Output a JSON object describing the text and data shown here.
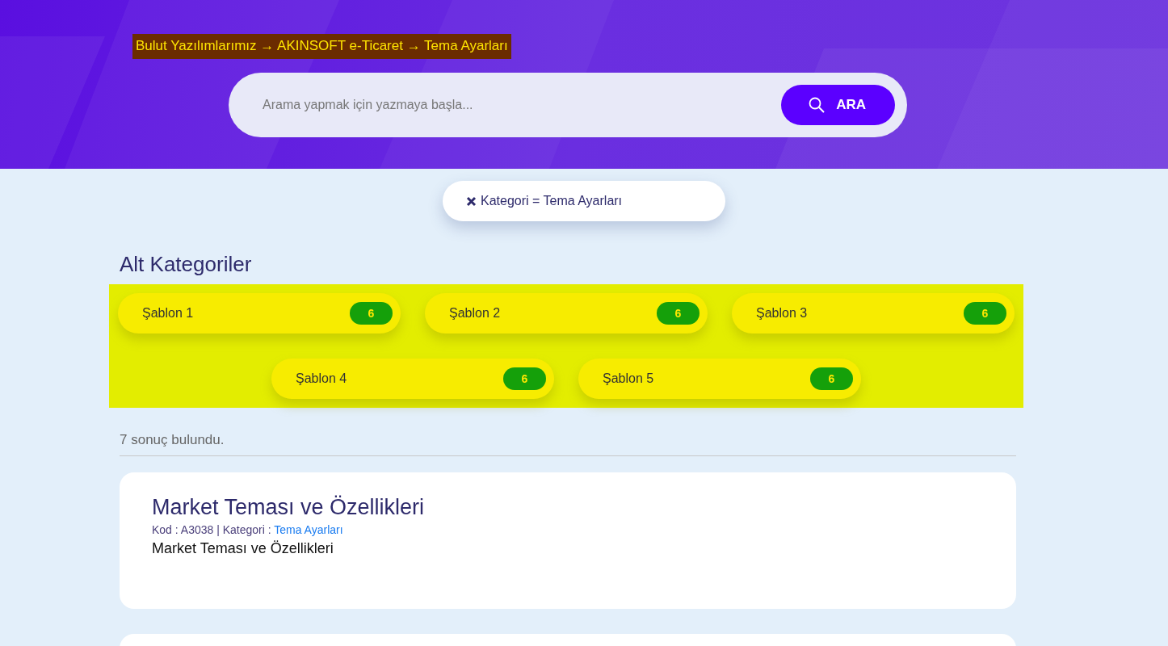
{
  "breadcrumb": "Bulut Yazılımlarımız → AKINSOFT e-Ticaret → Tema Ayarları",
  "search": {
    "placeholder": "Arama yapmak için yazmaya başla...",
    "button": "ARA"
  },
  "filter": {
    "label": "Kategori = Tema Ayarları"
  },
  "subcategories": {
    "title": "Alt Kategoriler",
    "items": [
      {
        "label": "Şablon 1",
        "count": "6"
      },
      {
        "label": "Şablon 2",
        "count": "6"
      },
      {
        "label": "Şablon 3",
        "count": "6"
      },
      {
        "label": "Şablon 4",
        "count": "6"
      },
      {
        "label": "Şablon 5",
        "count": "6"
      }
    ]
  },
  "result_count": "7 sonuç bulundu.",
  "results": [
    {
      "title": "Market Teması ve Özellikleri",
      "meta": "Kod : A3038 | Kategori : ",
      "category_link": "Tema Ayarları",
      "description": "Market Teması ve Özellikleri"
    }
  ]
}
